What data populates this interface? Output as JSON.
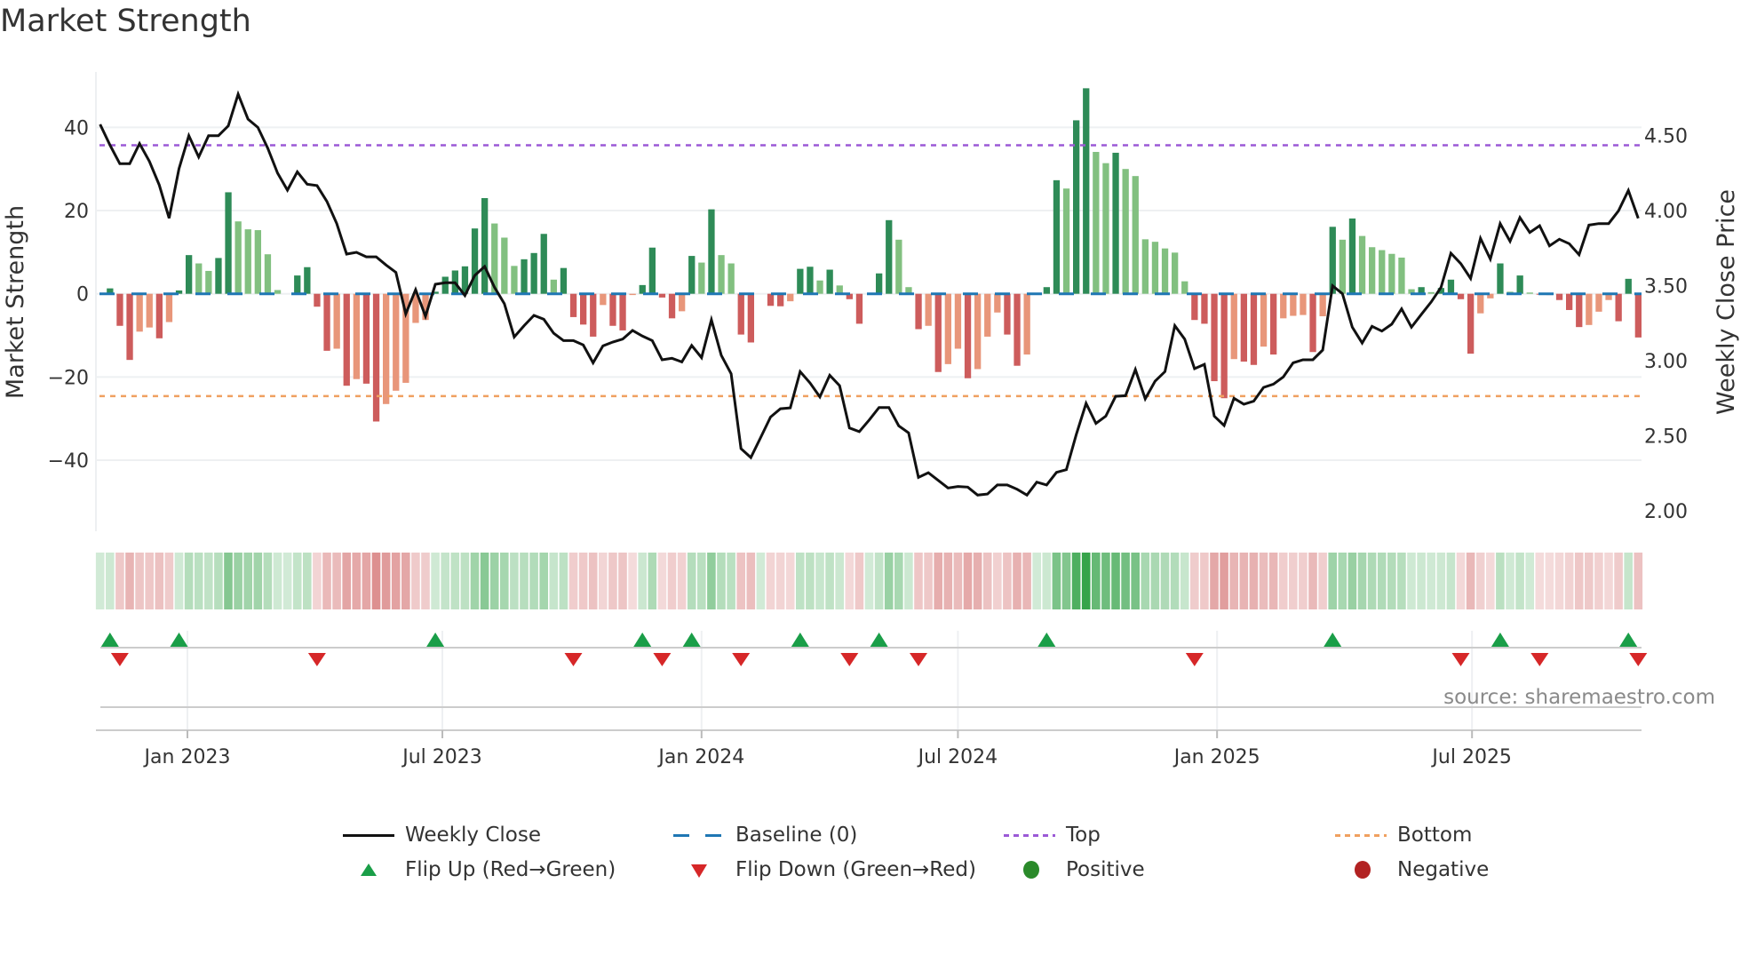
{
  "title": "Market Strength",
  "source": "source: sharemaestro.com",
  "colors": {
    "pos_up": "#2e8b57",
    "pos_down": "#82c080",
    "neg_down": "#cd5c5c",
    "neg_up": "#e8967a",
    "price": "#111111",
    "baseline": "#1f77b4",
    "top": "#9b59d6",
    "bottom": "#f0a060",
    "flip_up": "#1a9e48",
    "flip_down": "#d62728",
    "positive": "#2a8a2a",
    "negative": "#b22222"
  },
  "legend": [
    {
      "key": "weekly_close",
      "label": "Weekly Close"
    },
    {
      "key": "baseline",
      "label": "Baseline (0)"
    },
    {
      "key": "top",
      "label": "Top"
    },
    {
      "key": "bottom",
      "label": "Bottom"
    },
    {
      "key": "flip_up",
      "label": "Flip Up (Red→Green)"
    },
    {
      "key": "flip_down",
      "label": "Flip Down (Green→Red)"
    },
    {
      "key": "positive",
      "label": "Positive"
    },
    {
      "key": "negative",
      "label": "Negative"
    }
  ],
  "chart_data": {
    "type": "bar",
    "title": "Market Strength",
    "ylabel": "Market Strength",
    "y2label": "Weekly Close Price",
    "ylim": [
      -53,
      53
    ],
    "y2lim": [
      1.9,
      4.85
    ],
    "yticks": [
      40,
      20,
      0,
      -20,
      -40
    ],
    "yticklabels": [
      "40",
      "20",
      "0",
      "−20",
      "−40"
    ],
    "y2ticks": [
      4.5,
      4.0,
      3.5,
      3.0,
      2.5,
      2.0
    ],
    "y2ticklabels": [
      "4.50",
      "4.00",
      "3.50",
      "3.00",
      "2.50",
      "2.00"
    ],
    "grid": true,
    "legend_position": "bottom",
    "start_date": "2022-10-31",
    "frequency": "weekly",
    "xticks": [
      {
        "date": "2023-01-01",
        "label": "Jan 2023"
      },
      {
        "date": "2023-07-01",
        "label": "Jul 2023"
      },
      {
        "date": "2024-01-01",
        "label": "Jan 2024"
      },
      {
        "date": "2024-07-01",
        "label": "Jul 2024"
      },
      {
        "date": "2025-01-01",
        "label": "Jan 2025"
      },
      {
        "date": "2025-07-01",
        "label": "Jul 2025"
      }
    ],
    "top_level": 35.7,
    "bottom_level": -24.6,
    "baseline": 0,
    "strength": [
      0,
      1.3,
      -7.7,
      -15.9,
      -9.1,
      -8.1,
      -10.7,
      -6.8,
      0.8,
      9.3,
      7.3,
      5.5,
      8.6,
      24.4,
      17.4,
      15.5,
      15.3,
      9.5,
      0.9,
      0,
      4.4,
      6.4,
      -3.1,
      -13.7,
      -13.2,
      -22.1,
      -20.5,
      -21.6,
      -30.7,
      -26.5,
      -23.3,
      -21.4,
      -7,
      -6.3,
      0.5,
      4.1,
      5.6,
      6.6,
      15.7,
      23,
      16.9,
      13.5,
      6.7,
      8.3,
      9.8,
      14.4,
      3.4,
      6.2,
      -5.6,
      -7.4,
      -10.3,
      -2.7,
      -7.7,
      -8.8,
      -0.3,
      2.1,
      11.1,
      -0.9,
      -5.9,
      -4.2,
      9.1,
      7.5,
      20.3,
      9.3,
      7.3,
      -9.8,
      -11.7,
      0,
      -2.9,
      -3.0,
      -1.8,
      6.0,
      6.5,
      3.2,
      5.8,
      2.0,
      -1.3,
      -7.2,
      0,
      4.9,
      17.7,
      13.0,
      1.6,
      -8.5,
      -7.7,
      -18.8,
      -16.9,
      -13.2,
      -20.3,
      -18.1,
      -10.3,
      -4.5,
      -9.8,
      -17.3,
      -14.6,
      0,
      1.6,
      27.3,
      25.3,
      41.7,
      49.4,
      34.1,
      31.4,
      33.9,
      30.0,
      28.3,
      13.1,
      12.5,
      10.9,
      9.9,
      3.0,
      -6.3,
      -7.2,
      -21.0,
      -25.1,
      -15.7,
      -16.3,
      -17.1,
      -12.7,
      -14.6,
      -5.9,
      -5.3,
      -5.1,
      -14.0,
      -5.4,
      16.1,
      13.0,
      18.1,
      13.9,
      11.2,
      10.5,
      9.6,
      8.7,
      1.1,
      1.6,
      0.4,
      1.4,
      3.4,
      -1.3,
      -14.4,
      -4.7,
      -1.1,
      7.3,
      0.5,
      4.4,
      0.3,
      -0.1,
      -0.3,
      -1.5,
      -3.9,
      -8.0,
      -7.5,
      -4.3,
      -1.5,
      -6.6,
      3.6,
      -10.5
    ],
    "weekly_close": [
      4.574,
      4.436,
      4.312,
      4.312,
      4.446,
      4.327,
      4.17,
      3.949,
      4.278,
      4.499,
      4.357,
      4.499,
      4.499,
      4.564,
      4.775,
      4.609,
      4.554,
      4.416,
      4.249,
      4.136,
      4.258,
      4.176,
      4.166,
      4.061,
      3.913,
      3.71,
      3.722,
      3.692,
      3.692,
      3.637,
      3.588,
      3.312,
      3.473,
      3.296,
      3.509,
      3.519,
      3.519,
      3.434,
      3.568,
      3.627,
      3.489,
      3.38,
      3.158,
      3.233,
      3.302,
      3.276,
      3.183,
      3.134,
      3.134,
      3.105,
      2.986,
      3.099,
      3.124,
      3.144,
      3.201,
      3.164,
      3.134,
      3.006,
      3.016,
      2.992,
      3.101,
      3.02,
      3.272,
      3.036,
      2.913,
      2.414,
      2.355,
      2.489,
      2.625,
      2.68,
      2.686,
      2.927,
      2.852,
      2.759,
      2.903,
      2.834,
      2.552,
      2.527,
      2.605,
      2.688,
      2.688,
      2.566,
      2.519,
      2.223,
      2.254,
      2.203,
      2.152,
      2.162,
      2.158,
      2.105,
      2.112,
      2.172,
      2.172,
      2.144,
      2.105,
      2.191,
      2.172,
      2.256,
      2.274,
      2.507,
      2.716,
      2.582,
      2.631,
      2.763,
      2.767,
      2.941,
      2.746,
      2.864,
      2.927,
      3.233,
      3.144,
      2.947,
      2.976,
      2.631,
      2.568,
      2.75,
      2.71,
      2.73,
      2.822,
      2.844,
      2.892,
      2.986,
      3.006,
      3.006,
      3.071,
      3.499,
      3.446,
      3.223,
      3.118,
      3.229,
      3.197,
      3.243,
      3.345,
      3.223,
      3.308,
      3.391,
      3.489,
      3.716,
      3.647,
      3.548,
      3.815,
      3.677,
      3.913,
      3.795,
      3.953,
      3.854,
      3.899,
      3.765,
      3.809,
      3.779,
      3.706,
      3.903,
      3.913,
      3.913,
      3.998,
      4.134,
      3.948
    ],
    "flip_up_weeks": [
      1,
      8,
      34,
      55,
      60,
      71,
      79,
      96,
      125,
      142,
      155
    ],
    "flip_down_weeks": [
      2,
      22,
      48,
      57,
      65,
      76,
      83,
      111,
      138,
      146,
      156
    ]
  }
}
